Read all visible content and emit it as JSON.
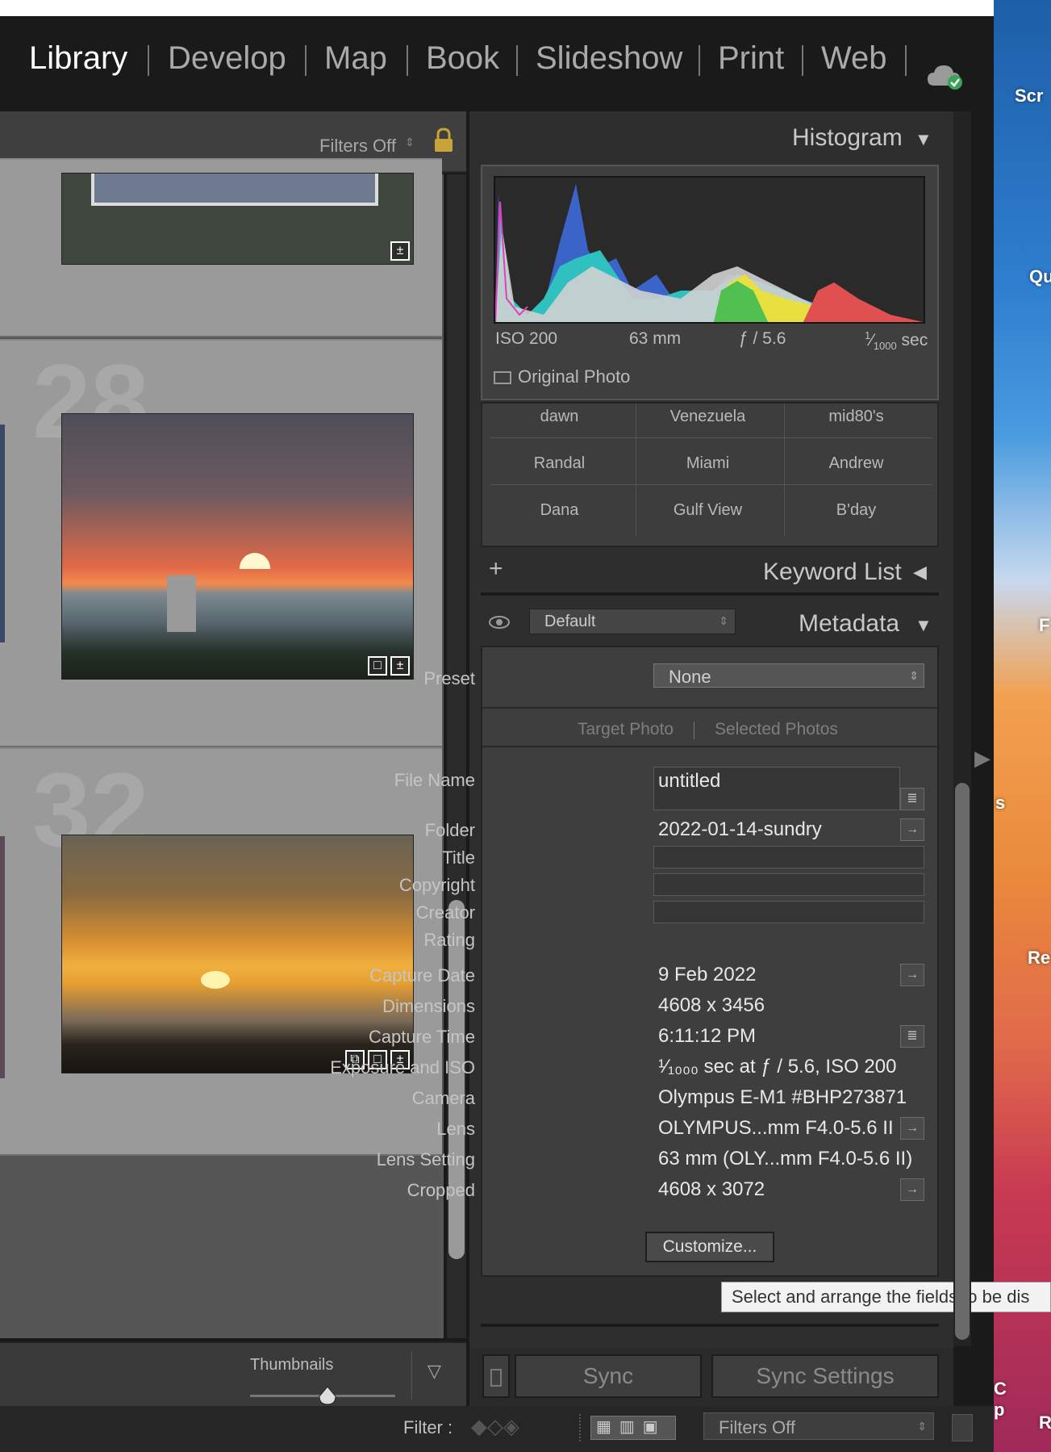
{
  "modules": [
    "Library",
    "Develop",
    "Map",
    "Book",
    "Slideshow",
    "Print",
    "Web"
  ],
  "active_module": "Library",
  "grid": {
    "filters_label": "Filters Off",
    "cells": [
      {
        "number": "28"
      },
      {
        "number": "32"
      }
    ],
    "thumbnails_label": "Thumbnails"
  },
  "histogram": {
    "title": "Histogram",
    "iso": "ISO 200",
    "focal": "63 mm",
    "aperture": "ƒ / 5.6",
    "shutter_num": "1",
    "shutter_den": "1000",
    "shutter_unit": "sec",
    "original_photo": "Original Photo"
  },
  "keywords": {
    "rows": [
      [
        "dawn",
        "Venezuela",
        "mid80's"
      ],
      [
        "Randal",
        "Miami",
        "Andrew"
      ],
      [
        "Dana",
        "Gulf View",
        "B'day"
      ]
    ],
    "list_title": "Keyword List",
    "add": "+"
  },
  "metadata": {
    "title": "Metadata",
    "view_select": "Default",
    "preset_label": "Preset",
    "preset_value": "None",
    "target_photo": "Target Photo",
    "selected_photos": "Selected Photos",
    "fields": {
      "file_name_label": "File Name",
      "file_name": "untitled",
      "folder_label": "Folder",
      "folder": "2022-01-14-sundry",
      "title_label": "Title",
      "copyright_label": "Copyright",
      "creator_label": "Creator",
      "rating_label": "Rating",
      "capture_date_label": "Capture Date",
      "capture_date": "9 Feb 2022",
      "dimensions_label": "Dimensions",
      "dimensions": "4608 x 3456",
      "capture_time_label": "Capture Time",
      "capture_time": "6:11:12 PM",
      "exposure_label": "Exposure and ISO",
      "exposure": "¹⁄₁₀₀₀ sec at ƒ / 5.6, ISO 200",
      "camera_label": "Camera",
      "camera": "Olympus E-M1 #BHP273871",
      "lens_label": "Lens",
      "lens": "OLYMPUS...mm F4.0-5.6 II",
      "lens_setting_label": "Lens Setting",
      "lens_setting": "63 mm (OLY...mm F4.0-5.6 II)",
      "cropped_label": "Cropped",
      "cropped": "4608 x 3072"
    },
    "customize": "Customize...",
    "tooltip": "Select and arrange the fields to be dis"
  },
  "sync": {
    "sync": "Sync",
    "sync_settings": "Sync Settings"
  },
  "filmstrip": {
    "filter_label": "Filter :",
    "filters_off": "Filters Off"
  },
  "desktop_labels": [
    "Scr",
    "Qu",
    "F",
    "s",
    "Re",
    "C",
    "p",
    "R"
  ]
}
